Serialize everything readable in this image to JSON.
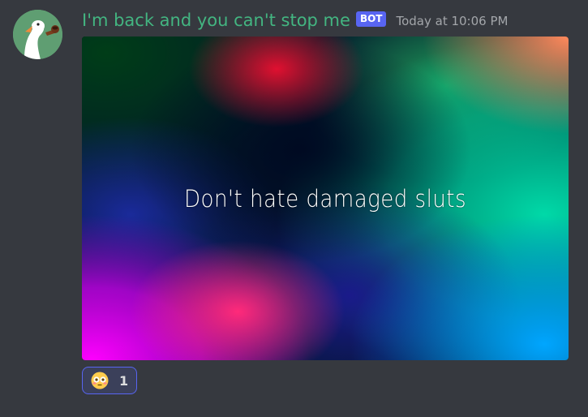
{
  "message": {
    "author": {
      "username": "I'm back and you can't stop me",
      "bot_tag": "BOT",
      "username_color": "#43b581",
      "avatar_icon": "goose-avatar"
    },
    "timestamp": "Today at 10:06 PM",
    "image": {
      "caption": "Don't hate damaged sluts"
    },
    "reactions": [
      {
        "emoji": "flushed-face-icon",
        "count": "1"
      }
    ]
  },
  "colors": {
    "background": "#36393f",
    "accent": "#5865f2",
    "timestamp": "#a3a6aa"
  }
}
